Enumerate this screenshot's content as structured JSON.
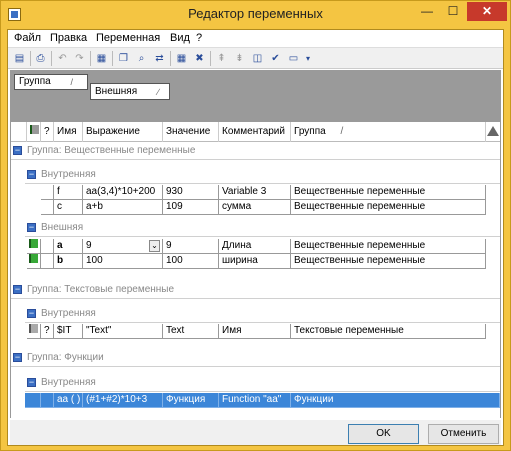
{
  "window": {
    "title": "Редактор переменных",
    "min": "—",
    "max": "☐",
    "close": "✕"
  },
  "menu": [
    "Файл",
    "Правка",
    "Переменная",
    "Вид",
    "?"
  ],
  "group_area": {
    "chip1": "Группа",
    "chip2": "Внешняя",
    "sort1": "/",
    "sort2": "∕"
  },
  "headers": {
    "flag": "",
    "q": "?",
    "name": "Имя",
    "expr": "Выражение",
    "value": "Значение",
    "comment": "Комментарий",
    "group": "Группа",
    "group_sort": "/"
  },
  "groups": [
    {
      "label": "Группа: Вещественные переменные",
      "sub": [
        {
          "label": "Внутренняя",
          "rows": [
            {
              "name": "f",
              "expr": "aa(3,4)*10+200",
              "value": "930",
              "comment": "Variable 3",
              "group": "Вещественные переменные"
            },
            {
              "name": "c",
              "expr": "a+b",
              "value": "109",
              "comment": "сумма",
              "group": "Вещественные переменные"
            }
          ]
        },
        {
          "label": "Внешняя",
          "rows": [
            {
              "name": "a",
              "expr": "9",
              "value": "9",
              "comment": "Длина",
              "group": "Вещественные переменные"
            },
            {
              "name": "b",
              "expr": "100",
              "value": "100",
              "comment": "ширина",
              "group": "Вещественные переменные"
            }
          ]
        }
      ]
    },
    {
      "label": "Группа: Текстовые переменные",
      "sub": [
        {
          "label": "Внутренняя",
          "rows": [
            {
              "q": "?",
              "name": "$IT",
              "expr": "\"Text\"",
              "value": "Text",
              "comment": "Имя",
              "group": "Текстовые переменные"
            }
          ]
        }
      ]
    },
    {
      "label": "Группа: Функции",
      "sub": [
        {
          "label": "Внутренняя",
          "rows": [
            {
              "name": "aa ( )",
              "expr": "(#1+#2)*10+3",
              "value": "Функция",
              "comment": "Function \"aa\"",
              "group": "Функции"
            }
          ]
        }
      ]
    }
  ],
  "buttons": {
    "ok": "OK",
    "cancel": "Отменить"
  },
  "colors": {
    "title_bar": "#f4c542",
    "selection": "#3c86d8",
    "flag_green": "#38a838"
  }
}
